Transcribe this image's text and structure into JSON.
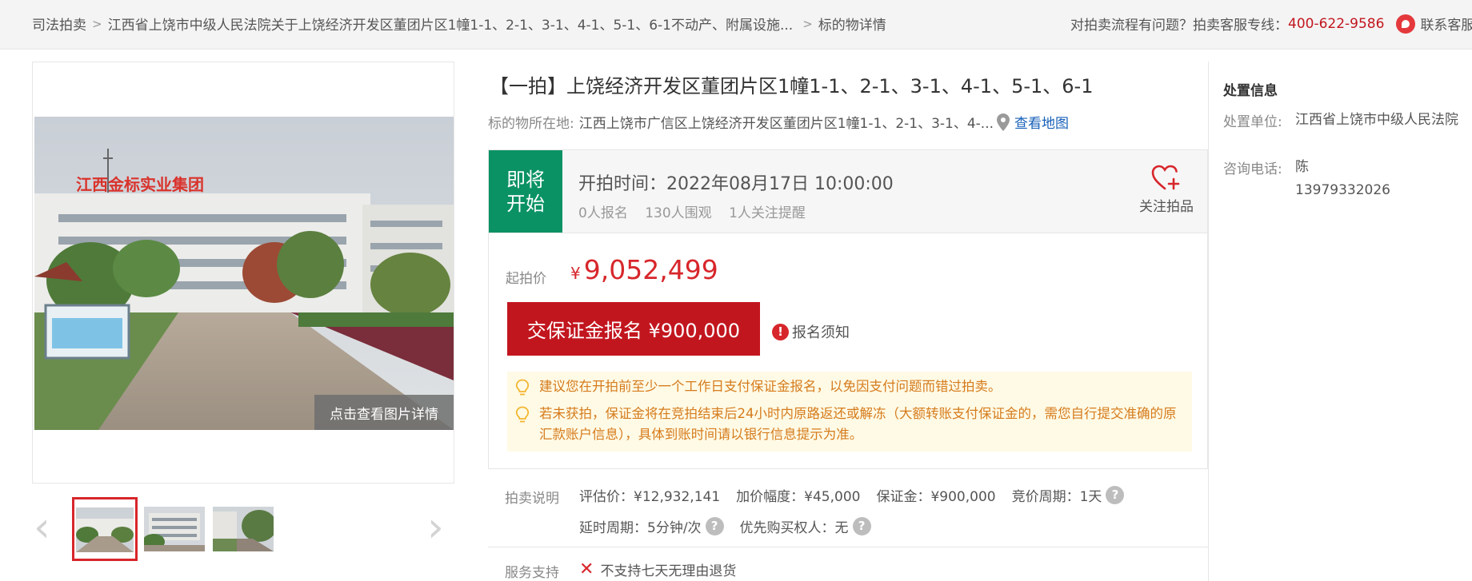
{
  "breadcrumb": {
    "root": "司法拍卖",
    "case": "江西省上饶市中级人民法院关于上饶经济开发区董团片区1幢1-1、2-1、3-1、4-1、5-1、6-1不动产、附属设施...",
    "current": "标的物详情"
  },
  "help": {
    "question": "对拍卖流程有问题？拍卖客服专线：",
    "phone": "400-622-9586",
    "contact": "联系客服"
  },
  "gallery": {
    "view_details": "点击查看图片详情",
    "photo_sign_text": "江西金标实业集团",
    "thumbnail_count": 3
  },
  "item": {
    "title": "【一拍】上饶经济开发区董团片区1幢1-1、2-1、3-1、4-1、5-1、6-1",
    "location_label": "标的物所在地:",
    "location": "江西上饶市广信区上饶经济开发区董团片区1幢1-1、2-1、3-1、4-...",
    "map_link": "查看地图"
  },
  "status": {
    "tag_line1": "即将",
    "tag_line2": "开始",
    "start_time": "开拍时间：2022年08月17日 10:00:00",
    "signups": "0人报名",
    "watchers": "130人围观",
    "reminders": "1人关注提醒",
    "follow_label": "关注拍品"
  },
  "bid": {
    "start_price_label": "起拍价",
    "currency": "¥",
    "start_price": "9,052,499",
    "deposit_button": "交保证金报名 ¥900,000",
    "notice": "报名须知",
    "tips": [
      "建议您在开拍前至少一个工作日支付保证金报名，以免因支付问题而错过拍卖。",
      "若未获拍，保证金将在竞拍结束后24小时内原路返还或解冻（大额转账支付保证金的，需您自行提交准确的原汇款账户信息），具体到账时间请以银行信息提示为准。"
    ]
  },
  "auction_info": {
    "label": "拍卖说明",
    "appraisal": "评估价：¥12,932,141",
    "increment": "加价幅度：¥45,000",
    "deposit": "保证金：¥900,000",
    "bid_cycle": "竞价周期：1天",
    "extension": "延时周期：5分钟/次",
    "preemption": "优先购买权人：无",
    "help_glyph": "?"
  },
  "service": {
    "label": "服务支持",
    "no_return": "不支持七天无理由退货"
  },
  "disposal": {
    "heading": "处置信息",
    "unit_label": "处置单位:",
    "unit": "江西省上饶市中级人民法院",
    "phone_label": "咨询电话:",
    "contact_name": "陈",
    "contact_phone": "13979332026"
  },
  "colors": {
    "accent_red": "#c2161f",
    "status_green": "#0a9265",
    "tip_orange": "#d57b1c",
    "link_blue": "#1760b8"
  }
}
